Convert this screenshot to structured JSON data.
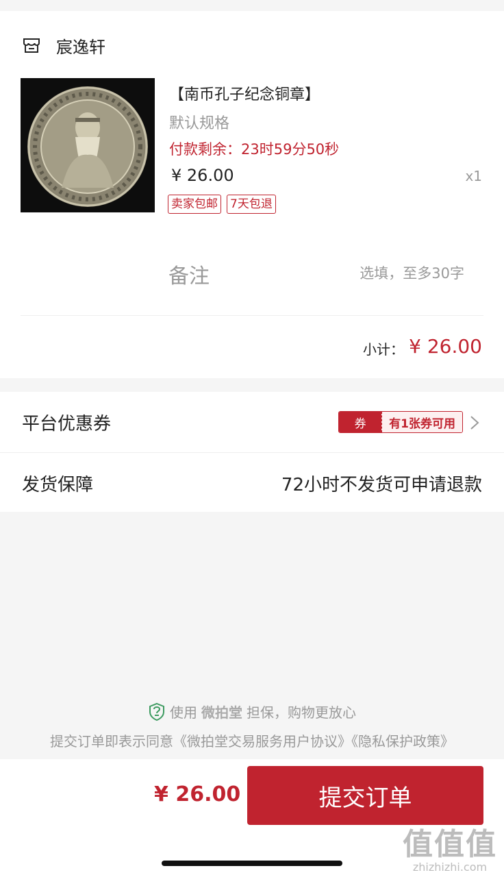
{
  "store": {
    "name": "宸逸轩",
    "icon": "store-icon"
  },
  "product": {
    "title": "【南币孔子纪念铜章】",
    "spec": "默认规格",
    "countdown_label": "付款剩余：",
    "countdown_value": "23时59分50秒",
    "price": "¥ 26.00",
    "quantity": "x1",
    "tags": [
      "卖家包邮",
      "7天包退"
    ]
  },
  "remark": {
    "label": "备注",
    "placeholder": "选填，至多30字"
  },
  "subtotal": {
    "label": "小计：",
    "value": "¥ 26.00"
  },
  "coupon": {
    "label": "平台优惠券",
    "badge_left": "券",
    "badge_right": "有1张券可用"
  },
  "shipping": {
    "label": "发货保障",
    "value": "72小时不发货可申请退款"
  },
  "guarantee": {
    "prefix": "使用",
    "brand": "微拍堂",
    "suffix": "担保，购物更放心",
    "agreement": "提交订单即表示同意《微拍堂交易服务用户协议》《隐私保护政策》"
  },
  "footer": {
    "total": "¥ 26.00",
    "submit_label": "提交订单"
  },
  "watermark": {
    "big": "值值值",
    "small": "zhizhizhi.com"
  },
  "colors": {
    "accent": "#c0232f",
    "muted": "#999999",
    "background": "#f5f5f5"
  }
}
